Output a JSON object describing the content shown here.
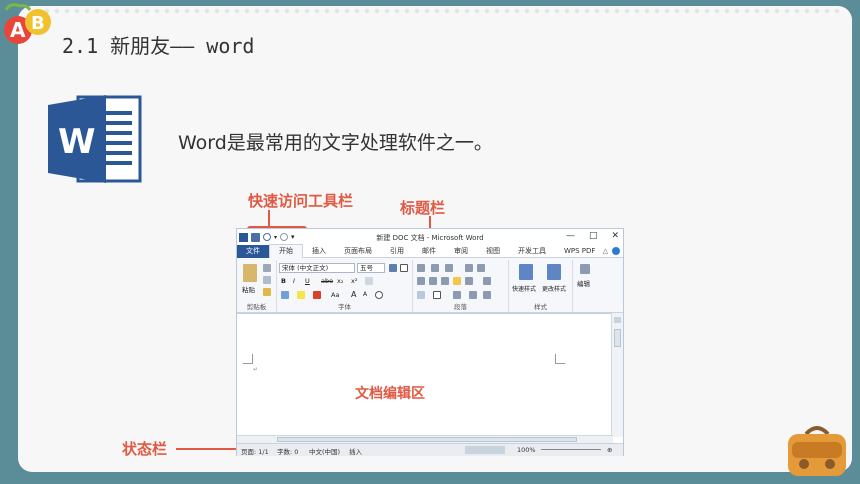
{
  "slide": {
    "title": "2.1 新朋友—— word",
    "subtitle": "Word是最常用的文字处理软件之一。",
    "logo_letters": "AB"
  },
  "annotations": {
    "quick_access": "快速访问工具栏",
    "title_bar": "标题栏",
    "doc_area": "文档编辑区",
    "status_bar": "状态栏"
  },
  "word_window": {
    "title": "新建 DOC 文档 - Microsoft Word",
    "window_buttons": [
      "—",
      "□",
      "✕"
    ],
    "tabs": [
      {
        "label": "文件"
      },
      {
        "label": "开始"
      },
      {
        "label": "插入"
      },
      {
        "label": "页面布局"
      },
      {
        "label": "引用"
      },
      {
        "label": "邮件"
      },
      {
        "label": "审阅"
      },
      {
        "label": "视图"
      },
      {
        "label": "开发工具"
      },
      {
        "label": "WPS PDF"
      }
    ],
    "ribbon": {
      "clipboard": {
        "label": "剪贴板",
        "paste": "粘贴"
      },
      "font": {
        "label": "字体",
        "font_name": "宋体 (中文正文)",
        "font_size": "五号",
        "bold": "B",
        "italic": "I",
        "underline": "U",
        "strike": "abe",
        "sub": "x₂",
        "sup": "x²",
        "aa": "Aa",
        "grow": "A",
        "shrink": "A"
      },
      "paragraph": {
        "label": "段落"
      },
      "styles": {
        "label": "样式",
        "quick_styles": "快速样式",
        "change_styles": "更改样式"
      },
      "editing": {
        "label": "编辑"
      }
    },
    "status": {
      "page": "页面: 1/1",
      "words": "字数: 0",
      "lang": "中文(中国)",
      "mode": "插入",
      "zoom": "100%"
    }
  },
  "colors": {
    "accent": "#e05a43",
    "word_blue": "#2b5797",
    "background": "#5b8d99"
  }
}
